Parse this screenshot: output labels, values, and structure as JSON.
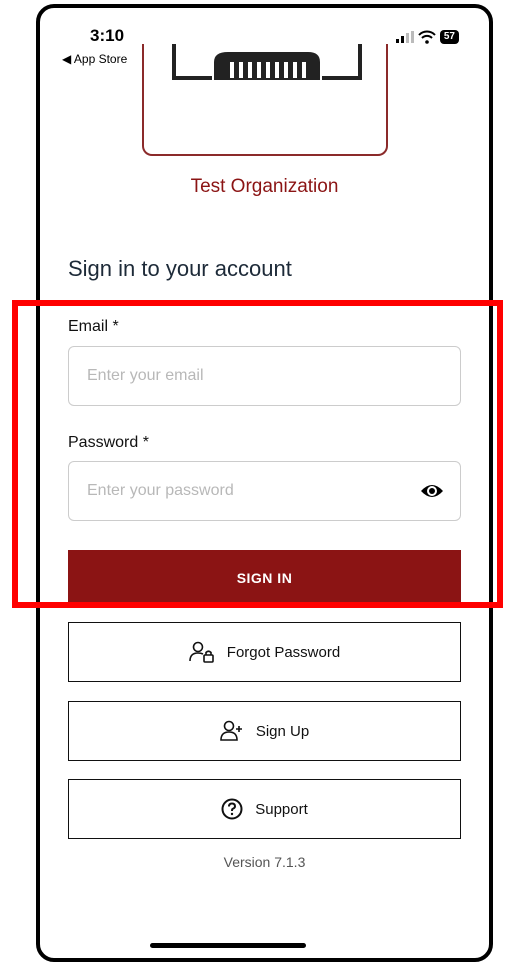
{
  "status_bar": {
    "time": "3:10",
    "back_label": "◀ App Store",
    "battery": "57"
  },
  "org": {
    "name": "Test Organization"
  },
  "form": {
    "heading": "Sign in to your account",
    "email_label": "Email *",
    "email_placeholder": "Enter your email",
    "password_label": "Password *",
    "password_placeholder": "Enter your password",
    "signin_label": "SIGN IN"
  },
  "actions": {
    "forgot_password": "Forgot Password",
    "sign_up": "Sign Up",
    "support": "Support"
  },
  "footer": {
    "version": "Version 7.1.3"
  },
  "colors": {
    "primary": "#8b1414",
    "highlight": "#ff0000"
  }
}
